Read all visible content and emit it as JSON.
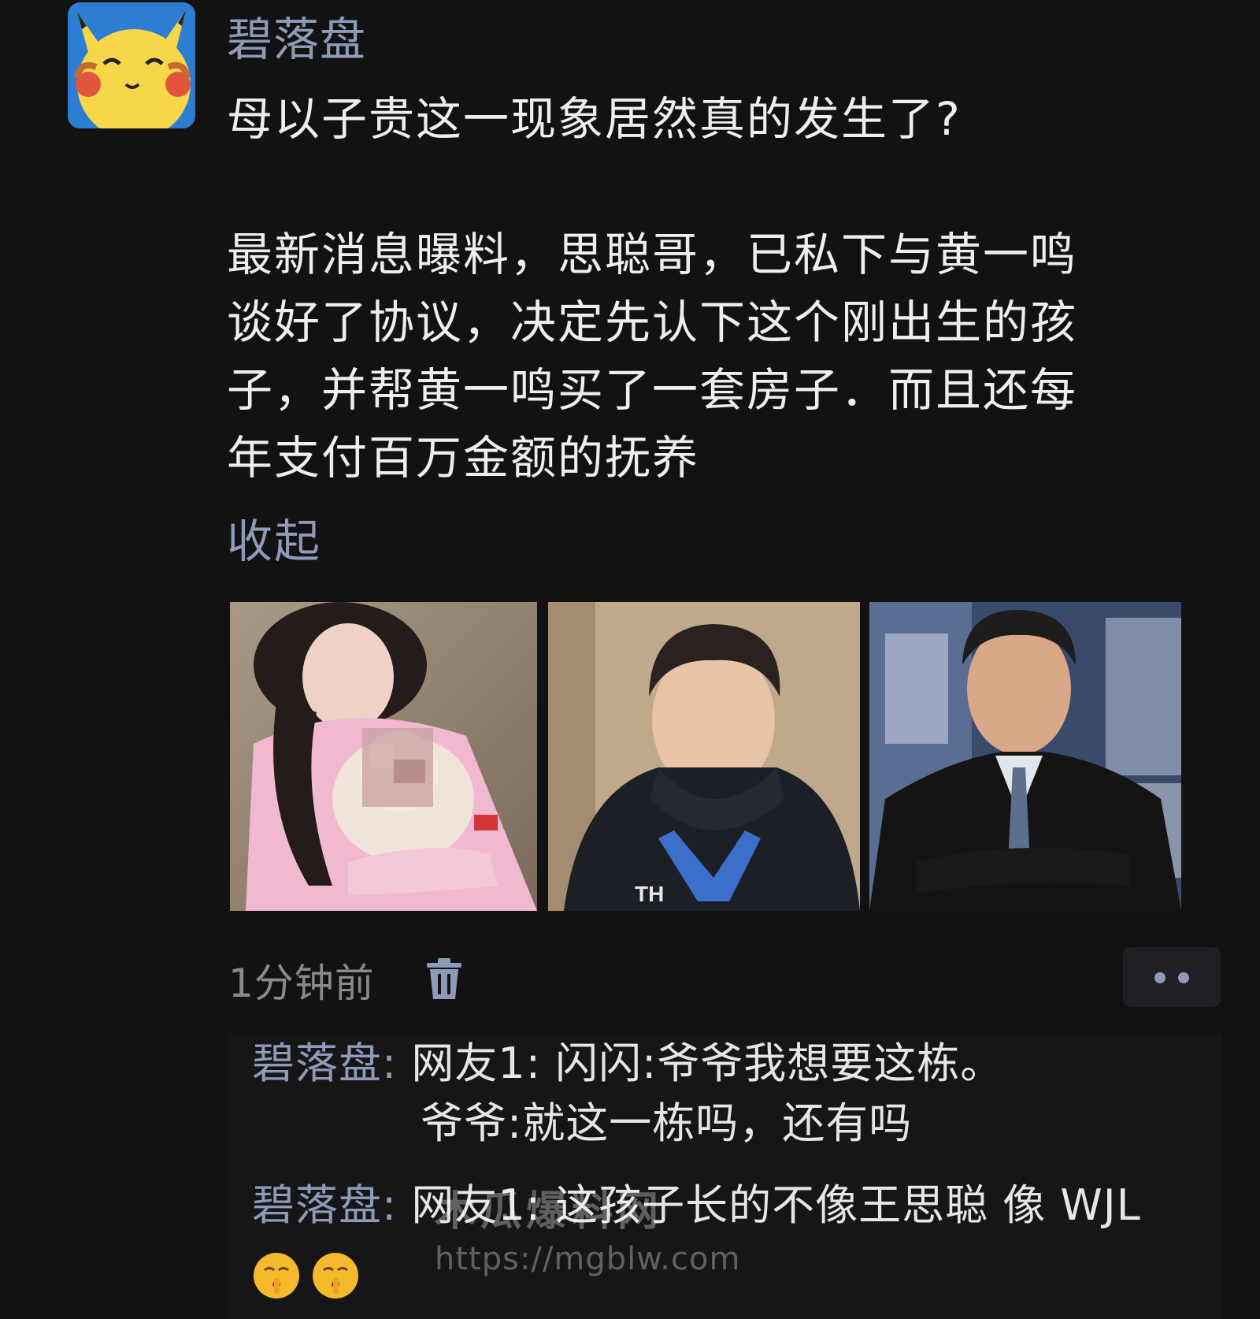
{
  "post": {
    "author": "碧落盘",
    "avatar_icon": "pikachu-avatar",
    "title": "母以子贵这一现象居然真的发生了?",
    "body_lines": [
      "最新消息曝料，思聪哥，已私下与黄一鸣",
      "谈好了协议，决定先认下这个刚出生的孩",
      "子，并帮黄一鸣买了一套房子．而且还每",
      "年支付百万金额的抚养"
    ],
    "collapse_label": "收起",
    "photos": [
      "woman-holding-baby-photo",
      "young-man-photo",
      "older-man-in-suit-photo"
    ],
    "time": "1分钟前",
    "delete_icon": "trash-icon",
    "more_icon": "more-dots-icon"
  },
  "comments": [
    {
      "user": "碧落盘:",
      "text": "网友1:  闪闪:爷爷我想要这栋。",
      "text2": "爷爷:就这一栋吗，还有吗"
    },
    {
      "user": "碧落盘:",
      "text": "网友1:  这孩子长的不像王思聪 像 WJL",
      "emojis": [
        "shush-face-emoji",
        "shush-face-emoji"
      ]
    }
  ],
  "watermark": {
    "name": "木瓜爆料网",
    "url": "https://mgblw.com"
  },
  "colors": {
    "background": "#121212",
    "username": "#8e9ab8",
    "text": "#eeeeee",
    "muted": "#8a8a8a"
  }
}
